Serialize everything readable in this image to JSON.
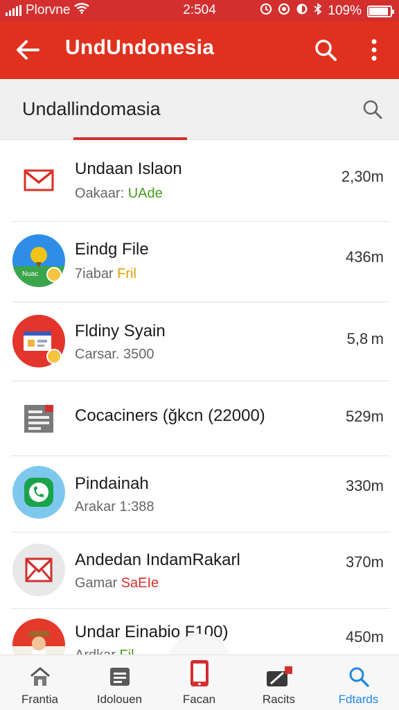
{
  "status_bar": {
    "carrier": "Plorvne",
    "time": "2:504",
    "battery": "109%",
    "battery_level": 0.9
  },
  "app_bar": {
    "title": "UndUndonesia",
    "back_icon": "arrow-left-icon",
    "search_icon": "search-icon",
    "more_icon": "more-vert-icon"
  },
  "tab": {
    "label": "Undallindomasia",
    "search_icon": "search-icon"
  },
  "colors": {
    "primary": "#e0311e",
    "status": "#d32f2f",
    "green_accent": "#4a9a1e",
    "orange_accent": "#e0a000",
    "red_accent": "#d32f2f",
    "link_blue": "#1e88e5"
  },
  "items": [
    {
      "name": "Undaan Islaon",
      "sub_prefix": "Oakaar",
      "sub_accent": "UAde",
      "accent_color": "#4a9a1e",
      "time": "2,30m",
      "icon": "gmail-icon"
    },
    {
      "name": "Eindg File",
      "sub_prefix": "7iabar",
      "sub_accent": "Fril",
      "accent_color": "#e0a000",
      "time": "436m",
      "icon": "landscape-app-icon"
    },
    {
      "name": "Fldiny Syain",
      "sub_prefix": "Carsar.",
      "sub_accent": "3500",
      "accent_color": "#777777",
      "time": "5,8 m",
      "icon": "slides-app-icon"
    },
    {
      "name": "Cocaciners (ğkcn (22000)",
      "sub_prefix": "",
      "sub_accent": "",
      "accent_color": "#777777",
      "time": "529m",
      "icon": "document-icon"
    },
    {
      "name": "Pindainah",
      "sub_prefix": "Arakar",
      "sub_accent": "1:388",
      "accent_color": "#777777",
      "time": "330m",
      "icon": "phone-chat-icon"
    },
    {
      "name": "Andedan IndamRakarl",
      "sub_prefix": "Gamar",
      "sub_accent": "SaEIe",
      "accent_color": "#d32f2f",
      "time": "370m",
      "icon": "mail-icon"
    },
    {
      "name": "Undar Einabio F100)",
      "sub_prefix": "Ardkar",
      "sub_accent": "Fil",
      "accent_color": "#4a9a1e",
      "time": "450m",
      "icon": "person-avatar-icon"
    }
  ],
  "nav": [
    {
      "label": "Frantia",
      "icon": "home-icon",
      "color": "#333333"
    },
    {
      "label": "Idolouen",
      "icon": "list-icon",
      "color": "#333333"
    },
    {
      "label": "Facan",
      "icon": "phone-icon",
      "color": "#333333"
    },
    {
      "label": "Racits",
      "icon": "edit-icon",
      "color": "#333333"
    },
    {
      "label": "Fdtards",
      "icon": "search-icon",
      "color": "#1e88e5"
    }
  ]
}
